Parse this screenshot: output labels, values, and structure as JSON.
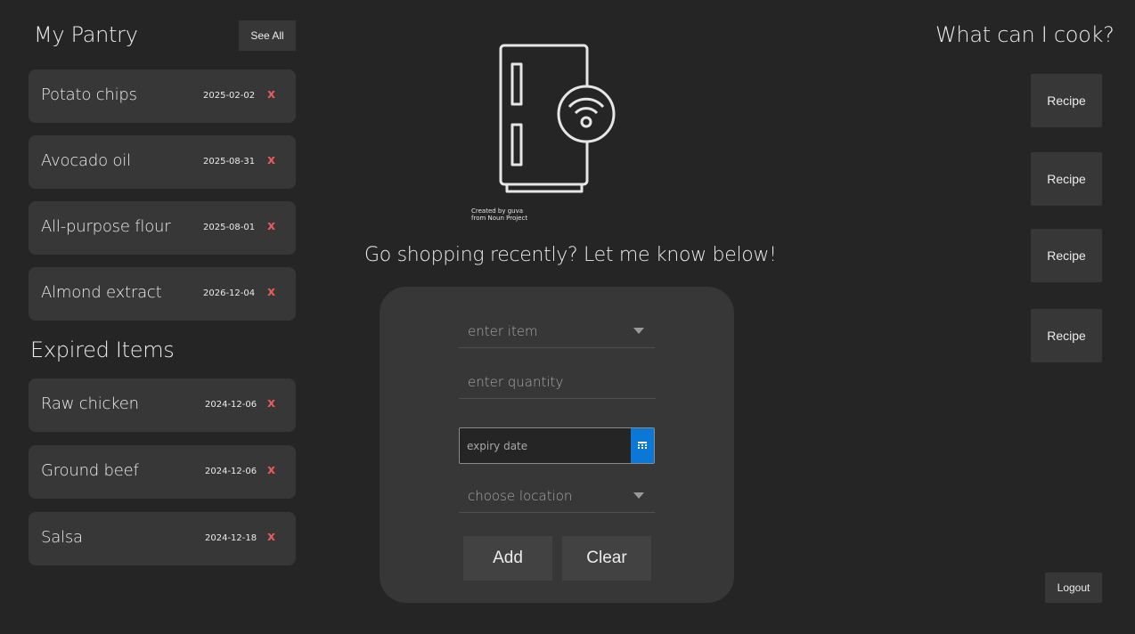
{
  "pantry": {
    "title": "My Pantry",
    "see_all_label": "See All",
    "items": [
      {
        "name": "Potato chips",
        "date": "2025-02-02",
        "remove": "x"
      },
      {
        "name": "Avocado oil",
        "date": "2025-08-31",
        "remove": "x"
      },
      {
        "name": "All-purpose flour",
        "date": "2025-08-01",
        "remove": "x"
      },
      {
        "name": "Almond extract",
        "date": "2026-12-04",
        "remove": "x"
      }
    ]
  },
  "expired": {
    "title": "Expired Items",
    "items": [
      {
        "name": "Raw chicken",
        "date": "2024-12-06",
        "remove": "x"
      },
      {
        "name": "Ground beef",
        "date": "2024-12-06",
        "remove": "x"
      },
      {
        "name": "Salsa",
        "date": "2024-12-18",
        "remove": "x"
      }
    ]
  },
  "hero": {
    "icon": "smart-fridge-icon",
    "credit_line1": "Created by guva",
    "credit_line2": "from Noun Project",
    "prompt": "Go shopping recently? Let me know below!"
  },
  "form": {
    "item_placeholder": "enter item",
    "quantity_placeholder": "enter quantity",
    "expiry_placeholder": "expiry date",
    "location_placeholder": "choose location",
    "add_label": "Add",
    "clear_label": "Clear"
  },
  "cook": {
    "title": "What can I cook?",
    "recipes": [
      "Recipe",
      "Recipe",
      "Recipe",
      "Recipe"
    ]
  },
  "logout_label": "Logout",
  "colors": {
    "background": "#252525",
    "card": "#373737",
    "delete": "#e85a5a",
    "accent": "#0a78d4"
  }
}
